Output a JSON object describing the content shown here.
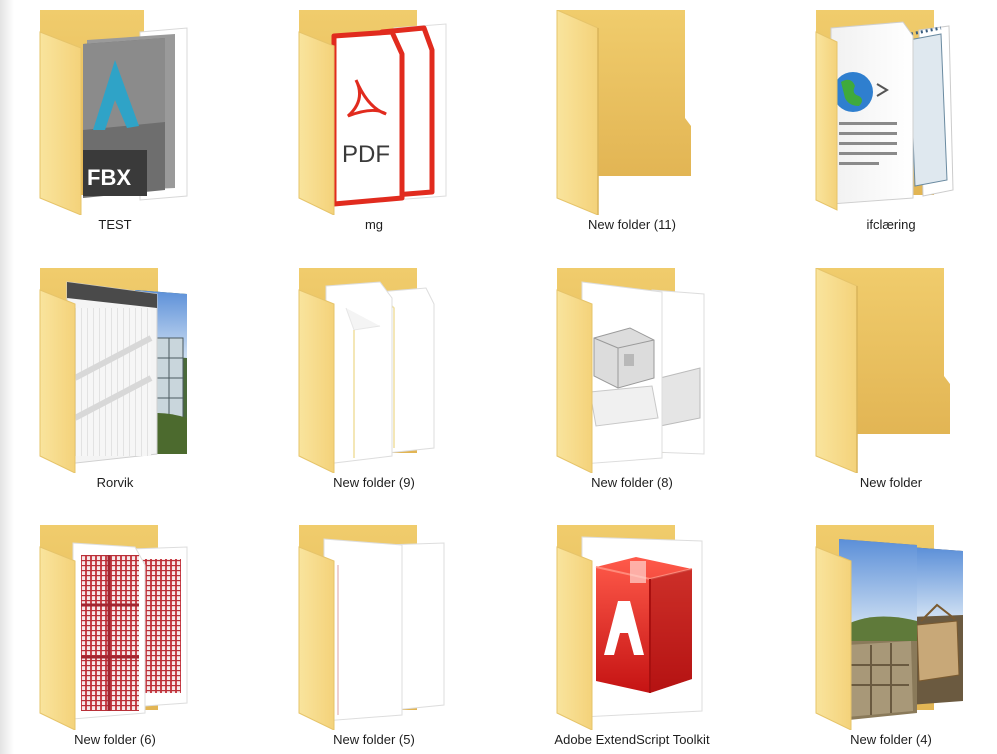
{
  "explorer": {
    "view": "large-icons",
    "items": [
      {
        "name": "TEST",
        "preview": "fbx-file-icon"
      },
      {
        "name": "mg",
        "preview": "pdf-file-icon"
      },
      {
        "name": "New folder (11)",
        "preview": "empty-folder-icon"
      },
      {
        "name": "ifclæring",
        "preview": "web-document-icon"
      },
      {
        "name": "Rorvik",
        "preview": "building-photo-thumbnail"
      },
      {
        "name": "New folder (9)",
        "preview": "blank-document-icon"
      },
      {
        "name": "New folder (8)",
        "preview": "house-model-thumbnail"
      },
      {
        "name": "New folder",
        "preview": "empty-folder-icon"
      },
      {
        "name": "New folder (6)",
        "preview": "red-drawing-thumbnail"
      },
      {
        "name": "New folder (5)",
        "preview": "blank-document-icon"
      },
      {
        "name": "Adobe ExtendScript Toolkit",
        "preview": "adobe-app-icon"
      },
      {
        "name": "New folder (4)",
        "preview": "construction-photo-thumbnail"
      }
    ]
  },
  "colors": {
    "folder_back": "#e8c062",
    "folder_front": "#f7dc8c",
    "label_text": "#1e1e1e",
    "adobe_red": "#d81f1f",
    "pdf_red": "#e12b1e"
  }
}
